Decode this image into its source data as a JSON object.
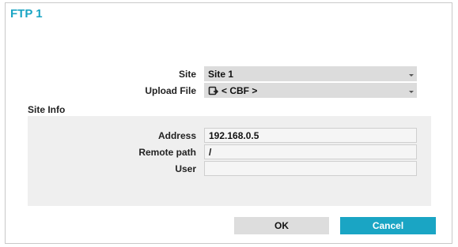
{
  "dialog": {
    "title": "FTP 1"
  },
  "form": {
    "site_label": "Site",
    "site_value": "Site 1",
    "upload_label": "Upload File",
    "upload_value": "< CBF >"
  },
  "site_info": {
    "section_label": "Site Info",
    "address_label": "Address",
    "address_value": "192.168.0.5",
    "remote_path_label": "Remote path",
    "remote_path_value": "/",
    "user_label": "User",
    "user_value": ""
  },
  "buttons": {
    "ok_label": "OK",
    "cancel_label": "Cancel"
  },
  "colors": {
    "accent": "#1aa5c4",
    "select_bg": "#dcdcdc",
    "panel_bg": "#efefef"
  },
  "icons": {
    "upload_file": "file-upload-icon",
    "dropdown": "chevron-down-icon"
  }
}
